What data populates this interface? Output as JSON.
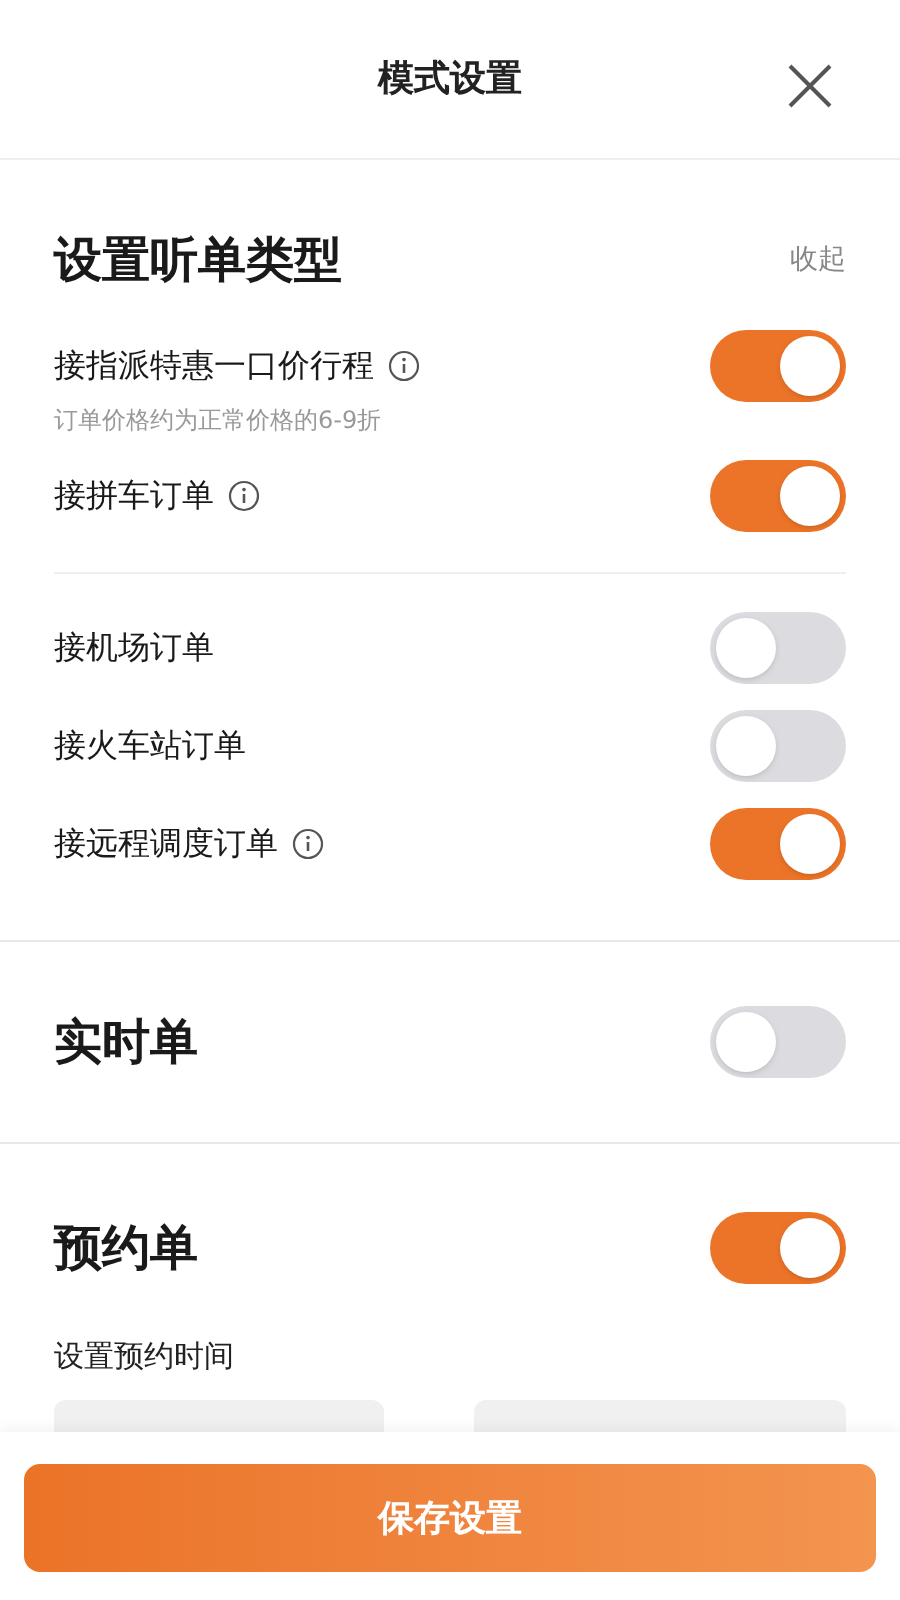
{
  "header": {
    "title": "模式设置"
  },
  "order_types": {
    "title": "设置听单类型",
    "collapse": "收起",
    "groups": [
      {
        "items": [
          {
            "label": "接指派特惠一口价行程",
            "info": true,
            "subtitle": "订单价格约为正常价格的6-9折",
            "on": true
          },
          {
            "label": "接拼车订单",
            "info": true,
            "on": true
          }
        ]
      },
      {
        "items": [
          {
            "label": "接机场订单",
            "info": false,
            "on": false
          },
          {
            "label": "接火车站订单",
            "info": false,
            "on": false
          },
          {
            "label": "接远程调度订单",
            "info": true,
            "on": true
          }
        ]
      }
    ]
  },
  "realtime": {
    "title": "实时单",
    "on": false
  },
  "reservation": {
    "title": "预约单",
    "on": true,
    "time_label": "设置预约时间"
  },
  "save_button": "保存设置"
}
